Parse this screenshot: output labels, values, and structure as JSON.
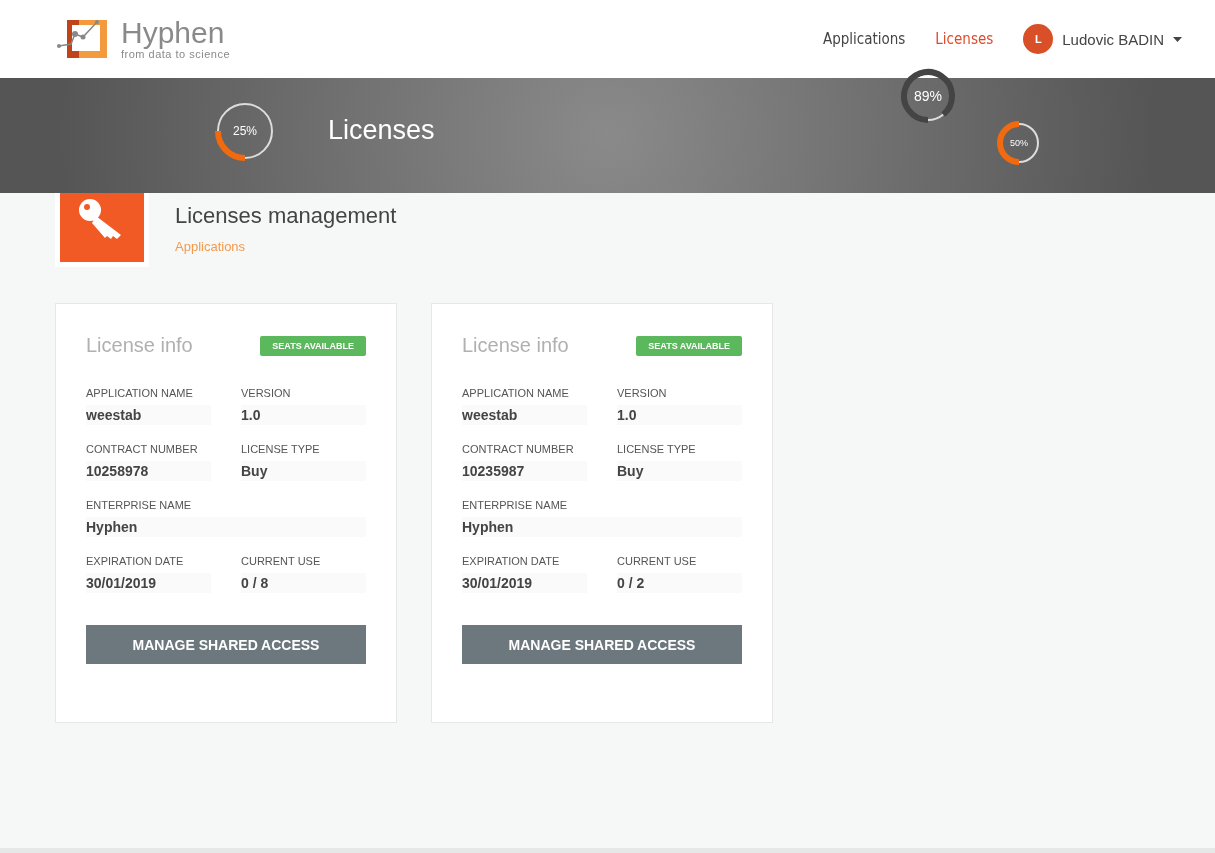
{
  "header": {
    "brand": "Hyphen",
    "tagline": "from data to science",
    "nav": [
      {
        "label": "Applications",
        "selected": false
      },
      {
        "label": "Licenses",
        "selected": true
      }
    ],
    "user": {
      "initial": "L",
      "name": "Ludovic BADIN"
    }
  },
  "banner": {
    "title": "Licenses",
    "gauges": [
      {
        "label": "25%",
        "level": 0.25
      },
      {
        "label": "89%",
        "level": 0.89
      },
      {
        "label": "50%",
        "level": 0.5
      }
    ]
  },
  "page": {
    "title": "Licenses management",
    "breadcrumb": "Applications"
  },
  "cards": [
    {
      "title": "License info",
      "badge": "SEATS AVAILABLE",
      "rows": [
        [
          {
            "label": "APPLICATION NAME",
            "value": "weestab"
          },
          {
            "label": "VERSION",
            "value": "1.0"
          }
        ],
        [
          {
            "label": "CONTRACT NUMBER",
            "value": "10258978"
          },
          {
            "label": "LICENSE TYPE",
            "value": "Buy"
          }
        ],
        [
          {
            "label": "ENTERPRISE NAME",
            "value": "Hyphen"
          }
        ],
        [
          {
            "label": "EXPIRATION DATE",
            "value": "30/01/2019"
          },
          {
            "label": "CURRENT USE",
            "value": "0 / 8"
          }
        ]
      ],
      "button": "MANAGE SHARED ACCESS"
    },
    {
      "title": "License info",
      "badge": "SEATS AVAILABLE",
      "rows": [
        [
          {
            "label": "APPLICATION NAME",
            "value": "weestab"
          },
          {
            "label": "VERSION",
            "value": "1.0"
          }
        ],
        [
          {
            "label": "CONTRACT NUMBER",
            "value": "10235987"
          },
          {
            "label": "LICENSE TYPE",
            "value": "Buy"
          }
        ],
        [
          {
            "label": "ENTERPRISE NAME",
            "value": "Hyphen"
          }
        ],
        [
          {
            "label": "EXPIRATION DATE",
            "value": "30/01/2019"
          },
          {
            "label": "CURRENT USE",
            "value": "0 / 2"
          }
        ]
      ],
      "button": "MANAGE SHARED ACCESS"
    }
  ]
}
